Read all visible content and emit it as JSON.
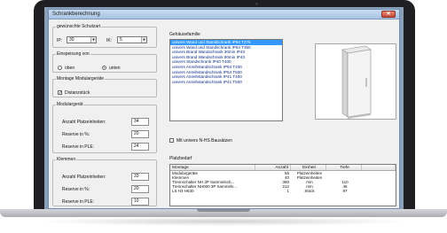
{
  "window": {
    "title": "Schrankberechnung",
    "close_glyph": "✕"
  },
  "schutzart": {
    "legend": "gewünschte Schutzart",
    "ip_label": "IP:",
    "ip_value": "30",
    "ik_label": "IK:",
    "ik_value": "5"
  },
  "einspeisung": {
    "legend": "Einspeisung von",
    "option_top": "oben",
    "option_bottom": "unten",
    "selected": "unten"
  },
  "montage_modulargeraete": {
    "legend": "Montage Modulargeräte",
    "checkbox_label": "Distanzstück",
    "checked": true
  },
  "modulargeraet": {
    "legend": "Modulargerät",
    "rows": [
      {
        "label": "Anzahl Platzeinheiten:",
        "value": "34"
      },
      {
        "label": "Reserve in %:",
        "value": "20"
      },
      {
        "label": "Reserve in PLE:",
        "value": "24"
      }
    ]
  },
  "klemmen": {
    "legend": "Klemmen",
    "rows": [
      {
        "label": "Anzahl Platzeinheiten:",
        "value": "33"
      },
      {
        "label": "Reserve in %:",
        "value": "20"
      },
      {
        "label": "Reserve in PLE:",
        "value": "10"
      }
    ]
  },
  "gehaeusefamilie": {
    "label": "Gehäusefamilie",
    "items": [
      "univers Wand und Standschrank IP54 T275",
      "univers Wand und Standschrank IP54 T350",
      "univers Brand Wandschrank 30min IP43",
      "univers Brand Wandschrank 90min IP43",
      "univers Standschrank IP40 T400",
      "univers Anreihstandschrank IP54 T400",
      "univers Anreihstandschrank IP54 T500",
      "univers Anreihstandschrank IP41 T400",
      "univers Anreihstandschrank IP41 T500"
    ],
    "selected_index": 0
  },
  "nhs_checkbox": {
    "label": "Mit univers N-HS Bausätzen",
    "checked": false
  },
  "platzbedarf": {
    "label": "Platzbedarf",
    "columns": [
      "Montage",
      "Anzahl",
      "Einheit",
      "Tiefe",
      ""
    ],
    "rows": [
      [
        "Modulargeräte",
        "55",
        "Platzeinheiten",
        "",
        ""
      ],
      [
        "Klemmen",
        "40",
        "Platzeinheiten",
        "",
        ""
      ],
      [
        "Trennschalter NH 3P Sammelsch...",
        "360",
        "mm",
        "110",
        ""
      ],
      [
        "Trennschalter NH000 3P Sammels...",
        "212",
        "mm",
        "46",
        ""
      ],
      [
        "LS H3 H630",
        "1",
        "Stück",
        "97",
        ""
      ]
    ]
  },
  "colors": {
    "accent": "#3399ff",
    "titlebar": "#a8c3e2",
    "close": "#c64b35",
    "bezel": "#1f1f21"
  }
}
